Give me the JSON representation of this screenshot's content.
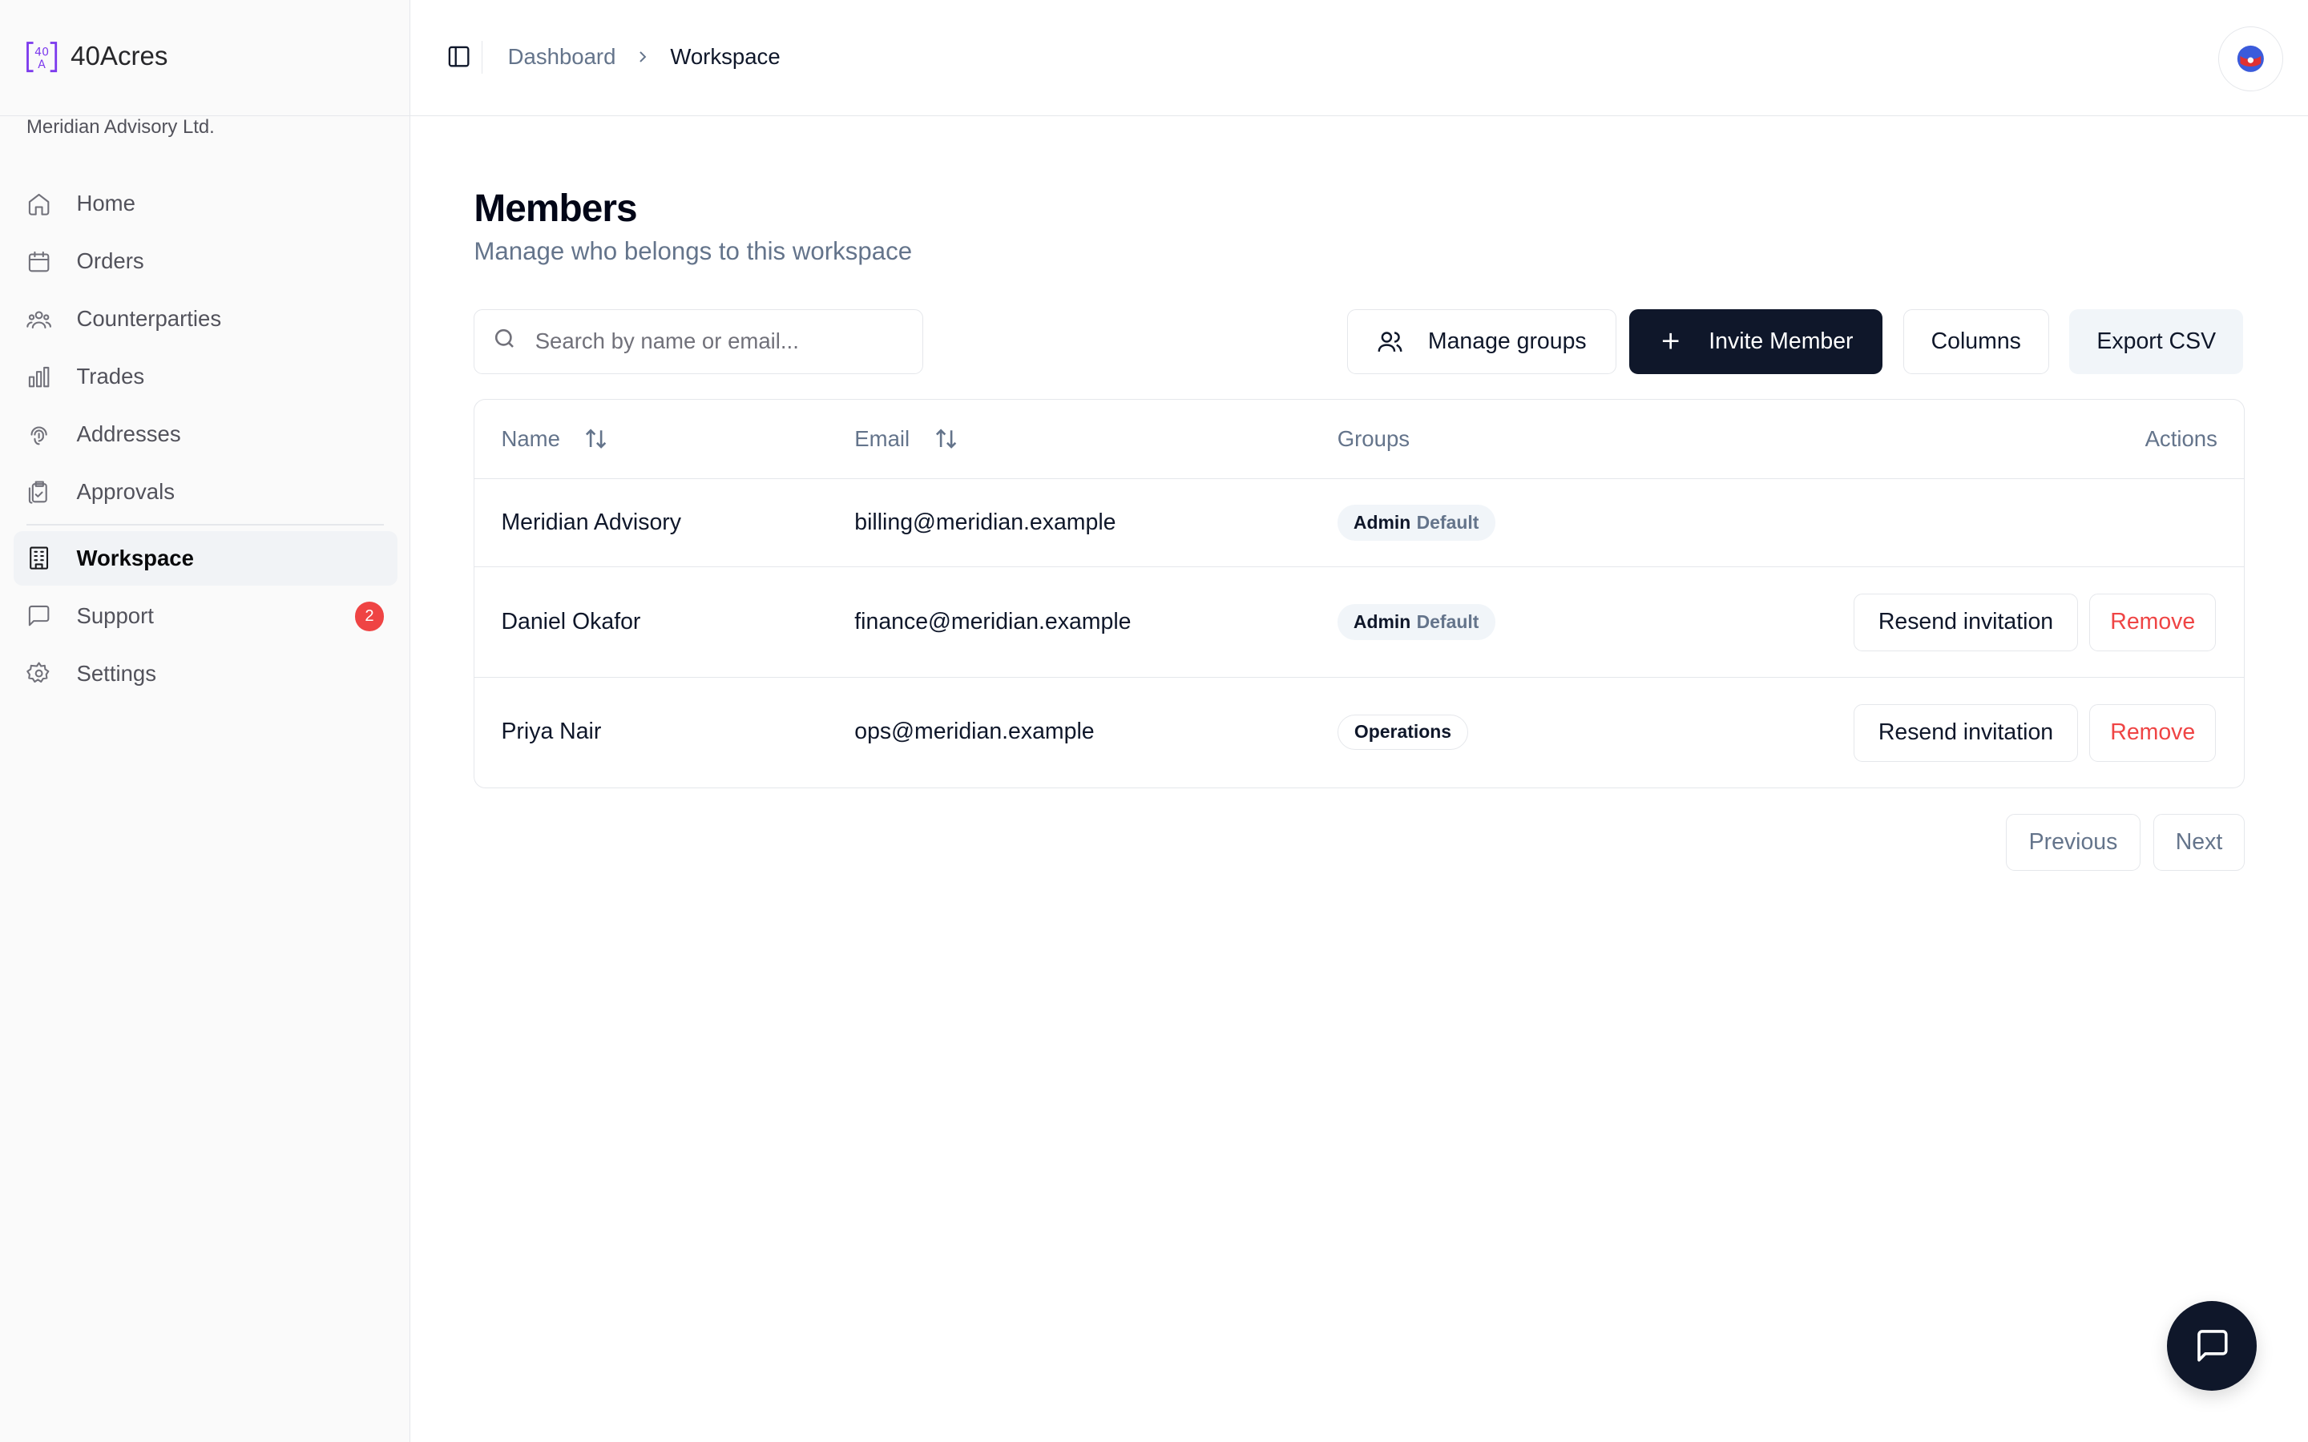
{
  "brand": {
    "name": "40Acres",
    "logo_color": "#7c3aed"
  },
  "org": {
    "name": "Meridian Advisory Ltd."
  },
  "nav": {
    "items": [
      {
        "label": "Home",
        "icon": "home-icon"
      },
      {
        "label": "Orders",
        "icon": "calendar-icon"
      },
      {
        "label": "Counterparties",
        "icon": "users-icon"
      },
      {
        "label": "Trades",
        "icon": "bar-chart-icon"
      },
      {
        "label": "Addresses",
        "icon": "fingerprint-icon"
      },
      {
        "label": "Approvals",
        "icon": "clipboard-check-icon"
      },
      {
        "label": "Workspace",
        "icon": "building-icon",
        "active": true
      },
      {
        "label": "Support",
        "icon": "message-square-icon",
        "badge": "2"
      },
      {
        "label": "Settings",
        "icon": "gear-icon"
      }
    ]
  },
  "breadcrumb": {
    "parent": "Dashboard",
    "current": "Workspace"
  },
  "page": {
    "title": "Members",
    "subtitle": "Manage who belongs to this workspace"
  },
  "search": {
    "placeholder": "Search by name or email..."
  },
  "toolbar": {
    "manage_groups": "Manage groups",
    "invite": "Invite Member",
    "columns": "Columns",
    "export": "Export CSV"
  },
  "table": {
    "headers": {
      "name": "Name",
      "email": "Email",
      "groups": "Groups",
      "actions": "Actions"
    },
    "rows": [
      {
        "name": "Meridian Advisory",
        "email": "billing@meridian.example",
        "group": "Admin",
        "group_sub": "Default"
      },
      {
        "name": "Daniel Okafor",
        "email": "finance@meridian.example",
        "group": "Admin",
        "group_sub": "Default",
        "resend": "Resend invitation",
        "remove": "Remove"
      },
      {
        "name": "Priya Nair",
        "email": "ops@meridian.example",
        "group": "Operations",
        "resend": "Resend invitation",
        "remove": "Remove"
      }
    ]
  },
  "pagination": {
    "previous": "Previous",
    "next": "Next"
  },
  "colors": {
    "primary": "#0f172a",
    "danger": "#ef4444",
    "muted": "#64748b",
    "border": "#e5e7eb"
  }
}
